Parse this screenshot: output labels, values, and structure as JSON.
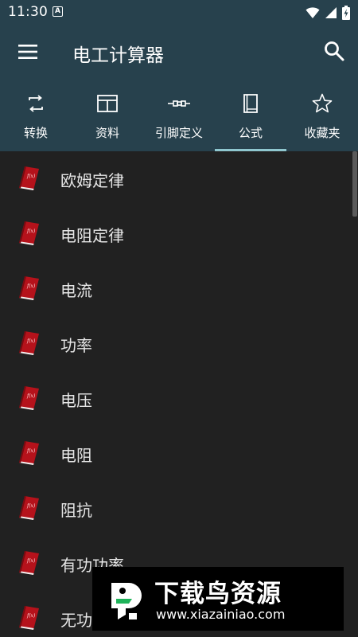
{
  "status_bar": {
    "time": "11:30",
    "notification_glyph": "A",
    "icons": [
      "wifi-icon",
      "cellular-signal-icon",
      "battery-charging-icon"
    ]
  },
  "app_bar": {
    "title": "电工计算器",
    "icons": [
      "menu-icon",
      "search-icon"
    ]
  },
  "tabs": [
    {
      "label": "转换",
      "icon": "convert-icon",
      "active": false
    },
    {
      "label": "资料",
      "icon": "table-icon",
      "active": false
    },
    {
      "label": "引脚定义",
      "icon": "connector-icon",
      "active": false
    },
    {
      "label": "公式",
      "icon": "book-icon",
      "active": true
    },
    {
      "label": "收藏夹",
      "icon": "star-icon",
      "active": false
    }
  ],
  "list": {
    "item_icon": "formula-book-icon",
    "items": [
      {
        "label": "欧姆定律"
      },
      {
        "label": "电阻定律"
      },
      {
        "label": "电流"
      },
      {
        "label": "功率"
      },
      {
        "label": "电压"
      },
      {
        "label": "电阻"
      },
      {
        "label": "阻抗"
      },
      {
        "label": "有功功率"
      },
      {
        "label": "无功功率"
      }
    ]
  },
  "watermark": {
    "text": "下载鸟资源",
    "url": "www.xiazainiao.com",
    "icon": "bird-logo-icon"
  },
  "colors": {
    "app_bar": "#27414d",
    "background": "#212121",
    "indicator": "#8fc7cf",
    "book_red": "#b5121b"
  }
}
